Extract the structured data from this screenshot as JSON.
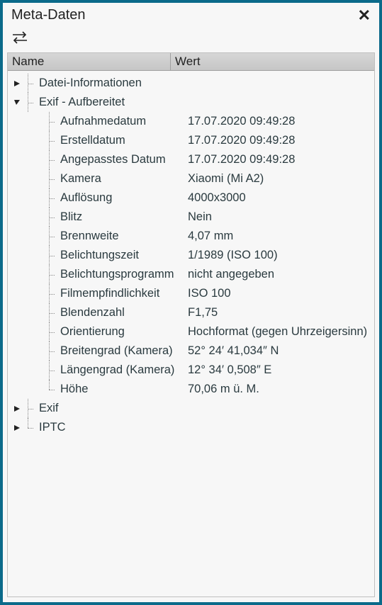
{
  "header": {
    "title": "Meta-Daten"
  },
  "columns": {
    "name": "Name",
    "value": "Wert"
  },
  "tree": {
    "groups": [
      {
        "label": "Datei-Informationen",
        "expanded": false
      },
      {
        "label": "Exif - Aufbereitet",
        "expanded": true,
        "items": [
          {
            "name": "Aufnahmedatum",
            "value": "17.07.2020 09:49:28"
          },
          {
            "name": "Erstelldatum",
            "value": "17.07.2020 09:49:28"
          },
          {
            "name": "Angepasstes Datum",
            "value": "17.07.2020 09:49:28"
          },
          {
            "name": "Kamera",
            "value": "Xiaomi (Mi A2)"
          },
          {
            "name": "Auflösung",
            "value": "4000x3000"
          },
          {
            "name": "Blitz",
            "value": "Nein"
          },
          {
            "name": "Brennweite",
            "value": "4,07 mm"
          },
          {
            "name": "Belichtungszeit",
            "value": "1/1989 (ISO 100)"
          },
          {
            "name": "Belichtungsprogramm",
            "value": "nicht angegeben"
          },
          {
            "name": "Filmempfindlichkeit",
            "value": "ISO 100"
          },
          {
            "name": "Blendenzahl",
            "value": "F1,75"
          },
          {
            "name": "Orientierung",
            "value": "Hochformat (gegen Uhrzeigersinn)"
          },
          {
            "name": "Breitengrad (Kamera)",
            "value": "52° 24′ 41,034″ N"
          },
          {
            "name": "Längengrad (Kamera)",
            "value": "12° 34′ 0,508″ E"
          },
          {
            "name": "Höhe",
            "value": "70,06 m ü. M."
          }
        ]
      },
      {
        "label": "Exif",
        "expanded": false
      },
      {
        "label": "IPTC",
        "expanded": false
      }
    ]
  }
}
